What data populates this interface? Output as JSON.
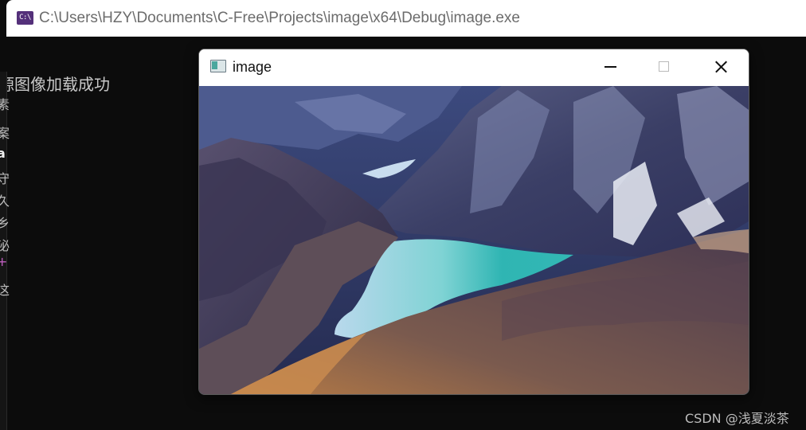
{
  "console": {
    "icon_text": "C:\\",
    "title": "C:\\Users\\HZY\\Documents\\C-Free\\Projects\\image\\x64\\Debug\\image.exe",
    "output_line": "源图像加载成功",
    "side_glyphs": [
      "素",
      "案",
      "a",
      "守",
      "久",
      "乡",
      "泌",
      "+",
      "这"
    ]
  },
  "image_window": {
    "title": "image",
    "minimize_icon": "minimize-icon",
    "maximize_icon": "maximize-icon",
    "close_icon": "close-icon",
    "accent": "#33b8b4"
  },
  "watermark": "CSDN @浅夏淡茶"
}
